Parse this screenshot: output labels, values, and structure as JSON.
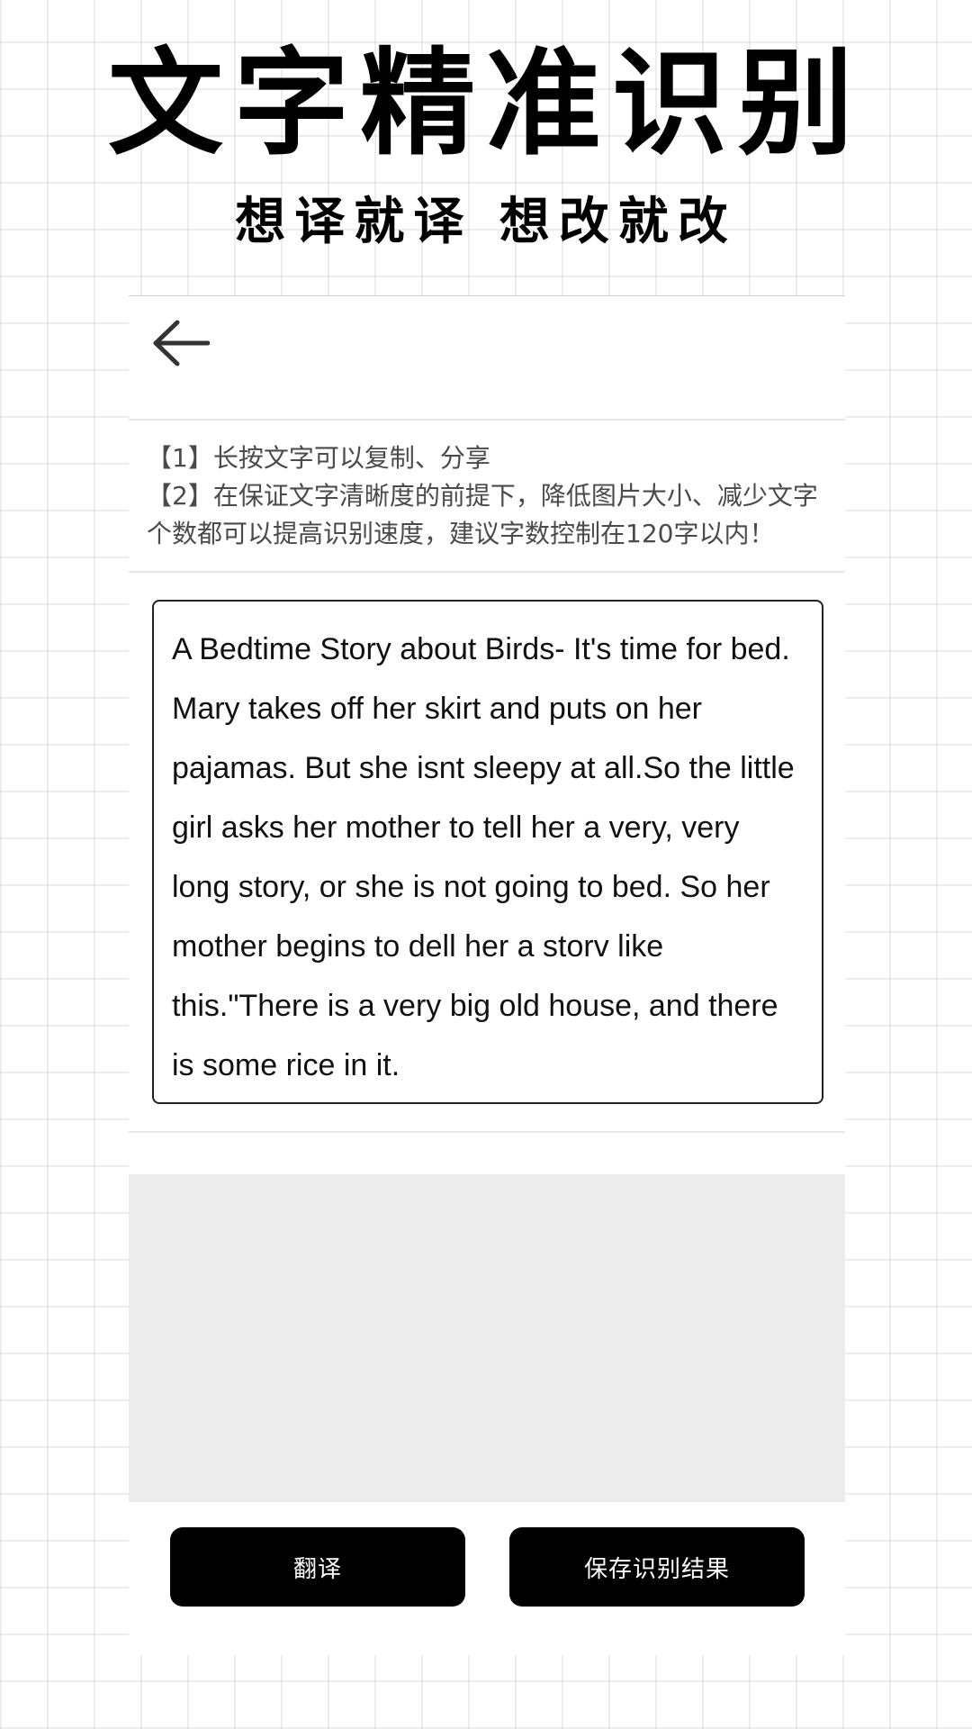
{
  "promo": {
    "headline": "文字精准识别",
    "subline": "想译就译  想改就改"
  },
  "toolbar": {
    "back_icon": "arrow-left-icon"
  },
  "tips": {
    "line1": "【1】长按文字可以复制、分享",
    "line2": "【2】在保证文字清晰度的前提下，降低图片大小、减少文字个数都可以提高识别速度，建议字数控制在120字以内！"
  },
  "result": {
    "text": "A Bedtime Story about Birds- It's time for bed. Mary takes off her skirt and puts on her pajamas. But she isnt sleepy at all.So the little girl asks her mother to tell her a very, very long story, or she is not going to bed. So her mother begins to dell her a storv like this.\"There is a very big old house, and there is some rice in it."
  },
  "translation": {
    "text": ""
  },
  "actions": {
    "translate_label": "翻译",
    "save_label": "保存识别结果"
  },
  "colors": {
    "button_bg": "#000000",
    "button_text": "#ffffff",
    "translation_bg": "#ececec"
  }
}
